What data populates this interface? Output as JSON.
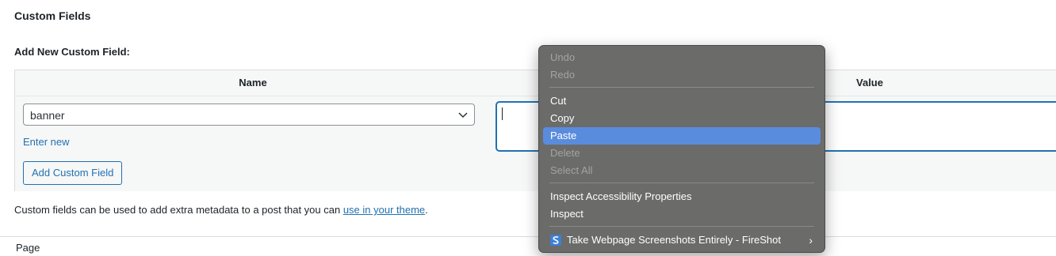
{
  "panel": {
    "title": "Custom Fields",
    "section_label": "Add New Custom Field:"
  },
  "table": {
    "col_name": "Name",
    "col_value": "Value",
    "name_select_value": "banner",
    "enter_new": "Enter new",
    "add_button": "Add Custom Field",
    "value_text": ""
  },
  "footnote": {
    "text": "Custom fields can be used to add extra metadata to a post that you can ",
    "link": "use in your theme",
    "end": "."
  },
  "bottom": {
    "label": "Page"
  },
  "context_menu": {
    "items": [
      {
        "label": "Undo",
        "enabled": false
      },
      {
        "label": "Redo",
        "enabled": false
      },
      {
        "label": "Cut",
        "enabled": true
      },
      {
        "label": "Copy",
        "enabled": true
      },
      {
        "label": "Paste",
        "enabled": true,
        "highlighted": true
      },
      {
        "label": "Delete",
        "enabled": false
      },
      {
        "label": "Select All",
        "enabled": false
      },
      {
        "label": "Inspect Accessibility Properties",
        "enabled": true
      },
      {
        "label": "Inspect",
        "enabled": true
      },
      {
        "label": "Take Webpage Screenshots Entirely - FireShot",
        "enabled": true,
        "icon": "fireshot-icon",
        "submenu": true
      }
    ]
  },
  "colors": {
    "link": "#2271b1",
    "menu_bg": "#6b6b6a",
    "menu_highlight": "#5a8cde"
  }
}
